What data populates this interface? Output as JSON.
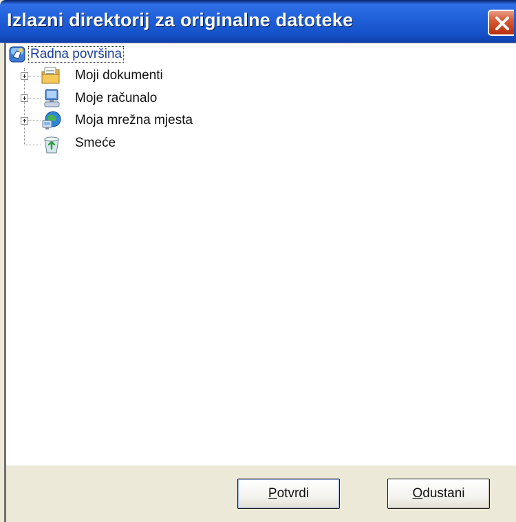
{
  "window": {
    "title": "Izlazni direktorij za originalne datoteke"
  },
  "icons": {
    "close": "close-icon",
    "desktop": "desktop-icon",
    "documents": "my-documents-icon",
    "computer": "my-computer-icon",
    "network": "network-places-icon",
    "recycle": "recycle-bin-icon"
  },
  "tree": {
    "root": {
      "label": "Radna površina",
      "selected": true
    },
    "items": [
      {
        "label": "Moji dokumenti",
        "expandable": true
      },
      {
        "label": "Moje računalo",
        "expandable": true
      },
      {
        "label": "Moja mrežna mjesta",
        "expandable": true
      },
      {
        "label": "Smeće",
        "expandable": false
      }
    ]
  },
  "buttons": {
    "ok": {
      "mnemonic": "P",
      "rest": "otvrdi"
    },
    "cancel": {
      "mnemonic": "O",
      "rest": "dustani"
    }
  },
  "colors": {
    "titlebar": "#1F5FD8",
    "close": "#D9603C",
    "face": "#ECE9D8",
    "selection_text": "#1C3E9A"
  }
}
